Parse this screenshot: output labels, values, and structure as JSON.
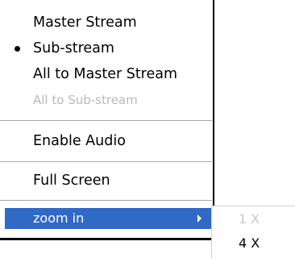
{
  "menu": {
    "items": [
      {
        "label": "Master Stream",
        "checked": false,
        "disabled": false
      },
      {
        "label": "Sub-stream",
        "checked": true,
        "disabled": false
      },
      {
        "label": "All to Master Stream",
        "checked": false,
        "disabled": false
      },
      {
        "label": "All to Sub-stream",
        "checked": false,
        "disabled": true
      },
      {
        "label": "Enable Audio",
        "checked": false,
        "disabled": false
      },
      {
        "label": "Full Screen",
        "checked": false,
        "disabled": false
      },
      {
        "label": "zoom in",
        "checked": false,
        "disabled": false,
        "has_submenu": true,
        "highlighted": true
      }
    ]
  },
  "submenu": {
    "items": [
      {
        "label": "1 X",
        "disabled": true
      },
      {
        "label": "4 X",
        "disabled": false
      }
    ]
  },
  "colors": {
    "highlight": "#3169c6",
    "disabled_text": "#b9b9b9",
    "separator": "#a9a9a9"
  }
}
